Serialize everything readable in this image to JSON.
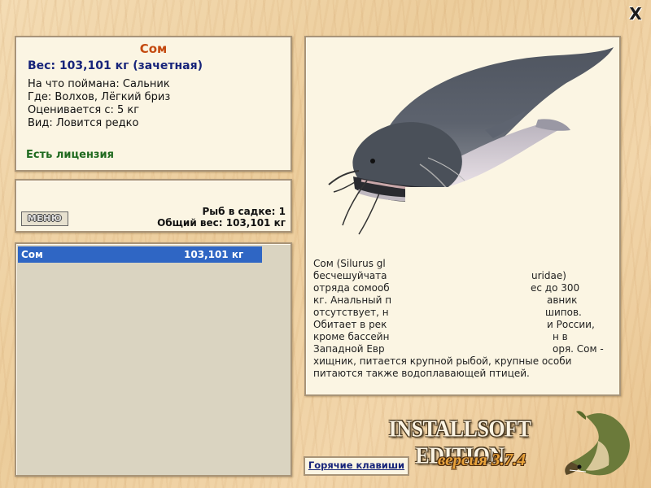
{
  "window": {
    "close_label": "X"
  },
  "fish_info": {
    "name": "Сом",
    "weight_line": "Вес: 103,101 кг (зачетная)",
    "caught_on": "На что поймана: Сальник",
    "location": "Где: Волхов, Лёгкий бриз",
    "valued_from": "Оценивается с: 5 кг",
    "species_line": "Вид: Ловится редко",
    "license": "Есть лицензия"
  },
  "keep_net": {
    "menu_label": "МЕНЮ",
    "count_line": "Рыб в садке: 1",
    "total_line": "Общий вес: 103,101 кг"
  },
  "catch_list": [
    {
      "name": "Сом",
      "weight": "103,101 кг"
    }
  ],
  "description": {
    "lines": [
      "Сом (Silurus gl",
      "бесчешуйчата",
      "отряда сомооб",
      "кг. Анальный п",
      "отсутствует, н",
      "Обитает в рек",
      "кроме бассейн",
      "Западной Евр",
      "хищник, питается крупной рыбой, крупные особи",
      "питаются также водоплавающей птицей."
    ],
    "right_fragments": [
      "uridae)",
      "ес до 300",
      "авник",
      "шипов.",
      "и России,",
      "н в",
      "оря. Сом -"
    ]
  },
  "footer": {
    "hotkeys_label": "Горячие клавиши",
    "edition": "INSTALLSOFT EDITION",
    "version": "версия 3.7.4"
  },
  "colors": {
    "title": "#c44a10",
    "weight": "#17247a",
    "license": "#1f6a1f",
    "selection": "#2f66c4"
  }
}
